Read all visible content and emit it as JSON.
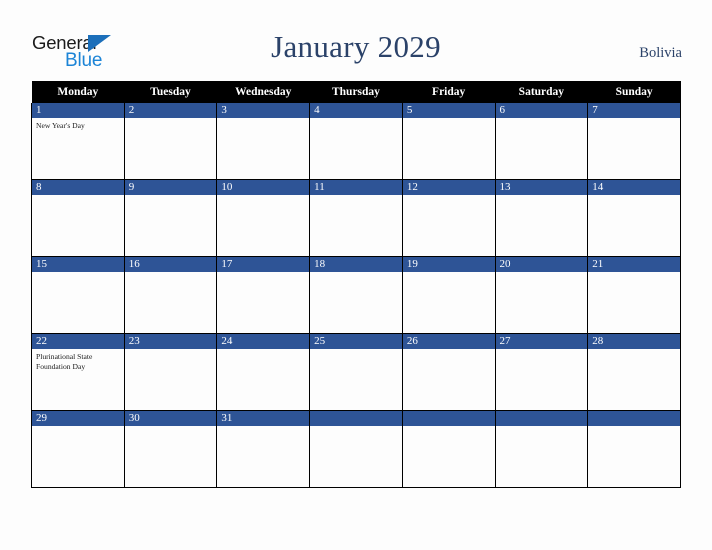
{
  "brand": {
    "name_part1": "General",
    "name_part2": "Blue",
    "triangle_icon": "triangle-icon",
    "colors": {
      "general_text": "#1b1b1b",
      "blue_text": "#1c84d6",
      "triangle": "#1c6fba"
    }
  },
  "header": {
    "title": "January 2029",
    "country": "Bolivia",
    "title_color": "#2b4269"
  },
  "calendar": {
    "weekday_headers": [
      "Monday",
      "Tuesday",
      "Wednesday",
      "Thursday",
      "Friday",
      "Saturday",
      "Sunday"
    ],
    "header_bg": "#000000",
    "daynum_bg": "#2e5496",
    "cell_bg": "#fdfdfd",
    "border_color": "#000000",
    "weeks": [
      [
        {
          "day": "1",
          "events": [
            "New Year's Day"
          ]
        },
        {
          "day": "2",
          "events": []
        },
        {
          "day": "3",
          "events": []
        },
        {
          "day": "4",
          "events": []
        },
        {
          "day": "5",
          "events": []
        },
        {
          "day": "6",
          "events": []
        },
        {
          "day": "7",
          "events": []
        }
      ],
      [
        {
          "day": "8",
          "events": []
        },
        {
          "day": "9",
          "events": []
        },
        {
          "day": "10",
          "events": []
        },
        {
          "day": "11",
          "events": []
        },
        {
          "day": "12",
          "events": []
        },
        {
          "day": "13",
          "events": []
        },
        {
          "day": "14",
          "events": []
        }
      ],
      [
        {
          "day": "15",
          "events": []
        },
        {
          "day": "16",
          "events": []
        },
        {
          "day": "17",
          "events": []
        },
        {
          "day": "18",
          "events": []
        },
        {
          "day": "19",
          "events": []
        },
        {
          "day": "20",
          "events": []
        },
        {
          "day": "21",
          "events": []
        }
      ],
      [
        {
          "day": "22",
          "events": [
            "Plurinational State Foundation Day"
          ]
        },
        {
          "day": "23",
          "events": []
        },
        {
          "day": "24",
          "events": []
        },
        {
          "day": "25",
          "events": []
        },
        {
          "day": "26",
          "events": []
        },
        {
          "day": "27",
          "events": []
        },
        {
          "day": "28",
          "events": []
        }
      ],
      [
        {
          "day": "29",
          "events": []
        },
        {
          "day": "30",
          "events": []
        },
        {
          "day": "31",
          "events": []
        },
        {
          "day": "",
          "events": []
        },
        {
          "day": "",
          "events": []
        },
        {
          "day": "",
          "events": []
        },
        {
          "day": "",
          "events": []
        }
      ]
    ]
  }
}
